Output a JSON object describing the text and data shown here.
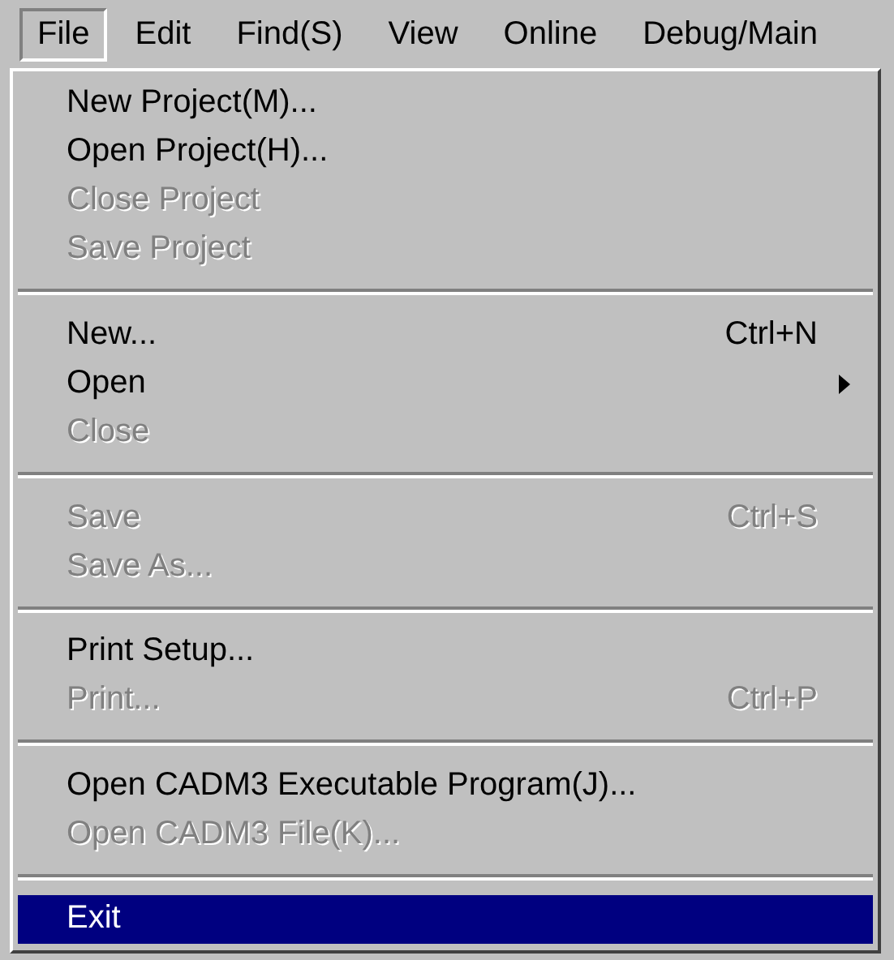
{
  "menubar": [
    {
      "label": "File",
      "selected": true
    },
    {
      "label": "Edit",
      "selected": false
    },
    {
      "label": "Find(S)",
      "selected": false
    },
    {
      "label": "View",
      "selected": false
    },
    {
      "label": "Online",
      "selected": false
    },
    {
      "label": "Debug/Main",
      "selected": false
    }
  ],
  "menu": {
    "sections": [
      {
        "items": [
          {
            "label": "New Project(M)...",
            "disabled": false,
            "selected": false
          },
          {
            "label": "Open Project(H)...",
            "disabled": false,
            "selected": false
          },
          {
            "label": "Close Project",
            "disabled": true,
            "selected": false
          },
          {
            "label": "Save Project",
            "disabled": true,
            "selected": false
          }
        ]
      },
      {
        "items": [
          {
            "label": "New...",
            "shortcut": "Ctrl+N",
            "disabled": false,
            "selected": false
          },
          {
            "label": "Open",
            "submenu": true,
            "disabled": false,
            "selected": false
          },
          {
            "label": "Close",
            "disabled": true,
            "selected": false
          }
        ]
      },
      {
        "items": [
          {
            "label": "Save",
            "shortcut": "Ctrl+S",
            "disabled": true,
            "selected": false
          },
          {
            "label": "Save As...",
            "disabled": true,
            "selected": false
          }
        ]
      },
      {
        "items": [
          {
            "label": "Print Setup...",
            "disabled": false,
            "selected": false
          },
          {
            "label": "Print...",
            "shortcut": "Ctrl+P",
            "disabled": true,
            "selected": false
          }
        ]
      },
      {
        "items": [
          {
            "label": "Open CADM3 Executable Program(J)...",
            "disabled": false,
            "selected": false
          },
          {
            "label": "Open CADM3 File(K)...",
            "disabled": true,
            "selected": false
          }
        ]
      },
      {
        "items": [
          {
            "label": "Exit",
            "disabled": false,
            "selected": true
          }
        ]
      }
    ]
  }
}
